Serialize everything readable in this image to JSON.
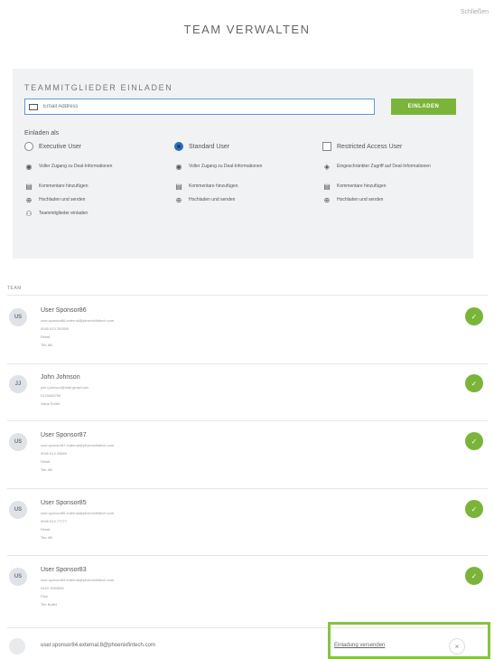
{
  "header": {
    "close_label": "Schließen",
    "title": "TEAM VERWALTEN"
  },
  "invite": {
    "heading": "TEAMMITGLIEDER EINLADEN",
    "email_placeholder": "Email Address",
    "button_label": "EINLADEN",
    "invite_as_label": "Einladen als",
    "roles": [
      {
        "label": "Executive User",
        "control": "radio",
        "selected": false,
        "permissions": [
          {
            "icon": "eye-icon",
            "text": "Voller Zugang zu Deal-Informationen"
          },
          {
            "icon": "comment-icon",
            "text": "Kommentare hinzufügen"
          },
          {
            "icon": "upload-icon",
            "text": "Hochladen und senden"
          },
          {
            "icon": "invite-icon",
            "text": "Teammitglieder einladen"
          }
        ]
      },
      {
        "label": "Standard User",
        "control": "radio",
        "selected": true,
        "permissions": [
          {
            "icon": "eye-icon",
            "text": "Voller Zugang zu Deal-Informationen"
          },
          {
            "icon": "comment-icon",
            "text": "Kommentare hinzufügen"
          },
          {
            "icon": "upload-icon",
            "text": "Hochladen und senden"
          }
        ]
      },
      {
        "label": "Restricted Access User",
        "control": "checkbox",
        "selected": false,
        "permissions": [
          {
            "icon": "limited-access-icon",
            "text": "Eingeschränkter Zugriff auf Deal-Informationen"
          },
          {
            "icon": "comment-icon",
            "text": "Kommentare hinzufügen"
          },
          {
            "icon": "upload-icon",
            "text": "Hochladen und senden"
          }
        ]
      }
    ]
  },
  "team": {
    "label": "TEAM",
    "members": [
      {
        "initials": "US",
        "name": "User Sponsor86",
        "lines": [
          "user.sponsor86.external@phoenixfintech.com",
          "0045 513 200895",
          "Retail",
          "Tier AB"
        ]
      },
      {
        "initials": "JJ",
        "name": "John Johnson",
        "lines": [
          "john.johnson@mail.gmail.com",
          "0123456789",
          "Value Bullet"
        ]
      },
      {
        "initials": "US",
        "name": "User Sponsor87",
        "lines": [
          "user.sponsor87.external@phoenixfintech.com",
          "0045 513 25889",
          "Retail",
          "Tier AB"
        ]
      },
      {
        "initials": "US",
        "name": "User Sponsor85",
        "lines": [
          "user.sponsor85.external@phoenixfintech.com",
          "0045 513 77777",
          "Retail",
          "Tier AB"
        ]
      },
      {
        "initials": "US",
        "name": "User Sponsor83",
        "lines": [
          "user.sponsor83.external@phoenixfintech.com",
          "0410 1050806",
          "Plan",
          "Tier Bullet"
        ]
      }
    ],
    "pending": {
      "email": "user.sponsor84.external.8@phoenixfintech.com",
      "resend_label": "Einladung versenden",
      "remove_symbol": "×"
    }
  },
  "colors": {
    "accent_green": "#7ab53a",
    "panel_bg": "#f1f2f4",
    "selected_radio": "#1c3f7a",
    "highlight_border": "#86c440"
  }
}
